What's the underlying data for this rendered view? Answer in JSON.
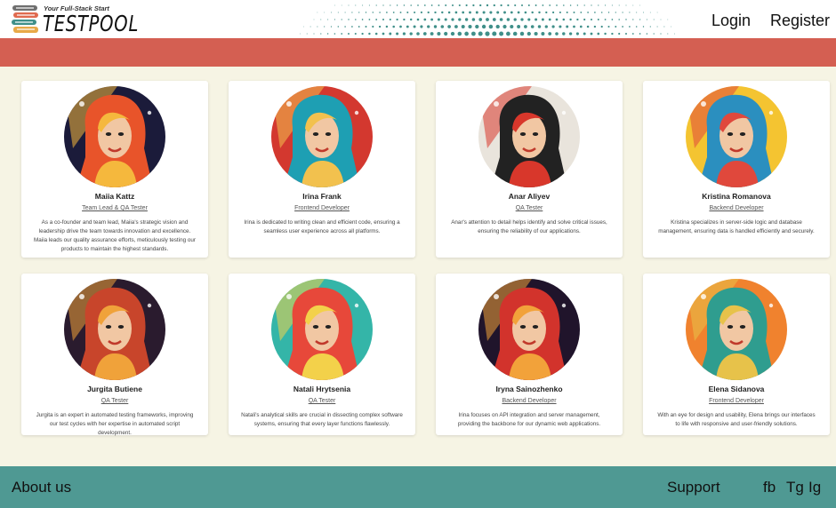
{
  "header": {
    "logo_tagline": "Your Full-Stack Start",
    "logo_name": "TESTPOOL",
    "nav": {
      "login": "Login",
      "register": "Register"
    }
  },
  "colors": {
    "banner": "#d45f52",
    "footer": "#4f9993",
    "background": "#f6f4e4",
    "dots": "#3f8f89"
  },
  "team": [
    {
      "name": "Maiia Kattz",
      "role": "Team Lead & QA Tester",
      "description": "As a co-founder and team lead, Maiia's strategic vision and leadership drive the team towards innovation and excellence. Maiia leads our quality assurance efforts, meticulously testing our products to maintain the highest standards.",
      "palette": [
        "#1b1b3a",
        "#e8542a",
        "#f5b83d"
      ]
    },
    {
      "name": "Irina Frank",
      "role": "Frontend Developer",
      "description": "Irina is dedicated to writing clean and efficient code, ensuring a seamless user experience across all platforms.",
      "palette": [
        "#d3382f",
        "#1e9fb3",
        "#f2c14e"
      ]
    },
    {
      "name": "Anar Aliyev",
      "role": "QA Tester",
      "description": "Anar's attention to detail helps identify and solve critical issues, ensuring the reliability of our applications.",
      "palette": [
        "#e9e4dc",
        "#222222",
        "#d8372b"
      ]
    },
    {
      "name": "Kristina Romanova",
      "role": "Backend Developer",
      "description": "Kristina specializes in server-side logic and database management, ensuring data is handled efficiently and securely.",
      "palette": [
        "#f4c431",
        "#2b8fbf",
        "#e0483c"
      ]
    },
    {
      "name": "Jurgita Butiene",
      "role": "QA Tester",
      "description": "Jurgita is an expert in automated testing frameworks, improving our test cycles with her expertise in automated script development.",
      "palette": [
        "#2a1b2e",
        "#c8452b",
        "#f0a23a"
      ]
    },
    {
      "name": "Natali Hrytsenia",
      "role": "QA Tester",
      "description": "Natali's analytical skills are crucial in dissecting complex software systems, ensuring that every layer functions flawlessly.",
      "palette": [
        "#34b5a8",
        "#e7483a",
        "#f3d14a"
      ]
    },
    {
      "name": "Iryna Sainozhenko",
      "role": "Backend Developer",
      "description": "Irina focuses on API integration and server management, providing the backbone for our dynamic web applications.",
      "palette": [
        "#20142b",
        "#d2332c",
        "#f2a23a"
      ]
    },
    {
      "name": "Elena Sidanova",
      "role": "Frontend Developer",
      "description": "With an eye for design and usability, Elena brings our interfaces to life with responsive and user-friendly solutions.",
      "palette": [
        "#f0822e",
        "#2f9d8f",
        "#e7c24a"
      ]
    }
  ],
  "footer": {
    "about": "About us",
    "support": "Support",
    "social": [
      "fb",
      "Tg",
      "Ig"
    ]
  }
}
